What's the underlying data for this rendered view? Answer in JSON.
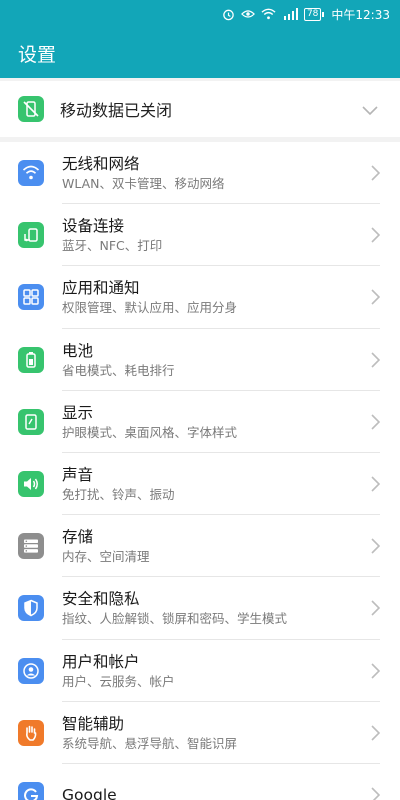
{
  "status_bar": {
    "battery": "78",
    "time": "中午12:33"
  },
  "app_bar": {
    "title": "设置"
  },
  "mobile_data": {
    "label": "移动数据已关闭",
    "icon": "mobile-data-off-icon",
    "color": "#37c46e"
  },
  "items": [
    {
      "title": "无线和网络",
      "subtitle": "WLAN、双卡管理、移动网络",
      "icon": "wifi-icon",
      "color": "#4b8ef0"
    },
    {
      "title": "设备连接",
      "subtitle": "蓝牙、NFC、打印",
      "icon": "device-connection-icon",
      "color": "#37c46e"
    },
    {
      "title": "应用和通知",
      "subtitle": "权限管理、默认应用、应用分身",
      "icon": "apps-grid-icon",
      "color": "#4b8ef0"
    },
    {
      "title": "电池",
      "subtitle": "省电模式、耗电排行",
      "icon": "battery-icon",
      "color": "#37c46e"
    },
    {
      "title": "显示",
      "subtitle": "护眼模式、桌面风格、字体样式",
      "icon": "display-icon",
      "color": "#37c46e"
    },
    {
      "title": "声音",
      "subtitle": "免打扰、铃声、振动",
      "icon": "speaker-icon",
      "color": "#37c46e"
    },
    {
      "title": "存储",
      "subtitle": "内存、空间清理",
      "icon": "storage-icon",
      "color": "#8e8e8e"
    },
    {
      "title": "安全和隐私",
      "subtitle": "指纹、人脸解锁、锁屏和密码、学生模式",
      "icon": "shield-icon",
      "color": "#4b8ef0"
    },
    {
      "title": "用户和帐户",
      "subtitle": "用户、云服务、帐户",
      "icon": "user-icon",
      "color": "#4b8ef0"
    },
    {
      "title": "智能辅助",
      "subtitle": "系统导航、悬浮导航、智能识屏",
      "icon": "hand-icon",
      "color": "#f07a2a"
    },
    {
      "title": "Google",
      "subtitle": "",
      "icon": "google-icon",
      "color": "#4b8ef0"
    }
  ]
}
